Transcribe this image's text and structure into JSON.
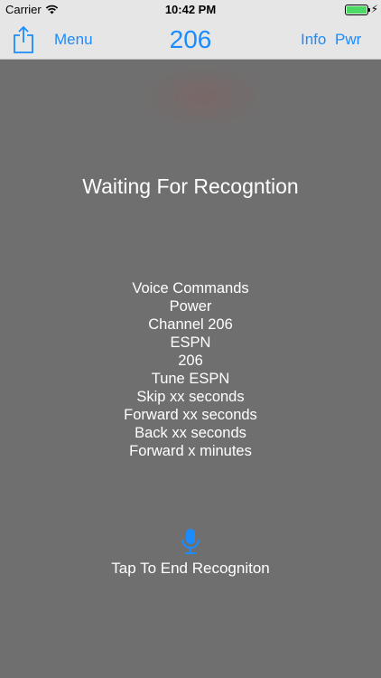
{
  "status_bar": {
    "carrier": "Carrier",
    "time": "10:42 PM",
    "battery_level": 1.0
  },
  "nav": {
    "menu_label": "Menu",
    "channel": "206",
    "info_label": "Info",
    "pwr_label": "Pwr"
  },
  "main": {
    "status_message": "Waiting For Recogntion",
    "commands": [
      "Voice Commands",
      "Power",
      "Channel 206",
      "ESPN",
      "206",
      "Tune ESPN",
      "Skip xx seconds",
      "Forward xx seconds",
      "Back xx seconds",
      "Forward x minutes"
    ],
    "tap_label": "Tap To End Recogniton"
  },
  "icons": {
    "share": "share-icon",
    "mic": "microphone-icon",
    "wifi": "wifi-icon",
    "battery": "battery-icon"
  },
  "colors": {
    "accent": "#1a8cff",
    "overlay": "#6f6f6f",
    "bar": "#e6e6e6",
    "battery": "#4cd964"
  }
}
